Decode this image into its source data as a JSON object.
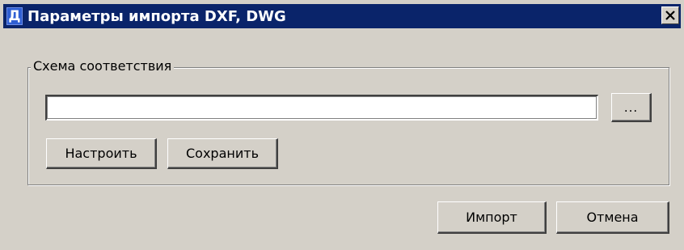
{
  "window": {
    "title": "Параметры импорта DXF, DWG",
    "icon_letter": "Д",
    "icon": "app-icon",
    "close_icon": "close-icon",
    "colors": {
      "titlebar": "#0a246a",
      "face": "#d4d0c8"
    }
  },
  "mapping_group": {
    "label": "Схема соответствия",
    "path_value": "",
    "browse_label": "...",
    "configure_label": "Настроить",
    "save_label": "Сохранить"
  },
  "footer": {
    "import_label": "Импорт",
    "cancel_label": "Отмена"
  }
}
